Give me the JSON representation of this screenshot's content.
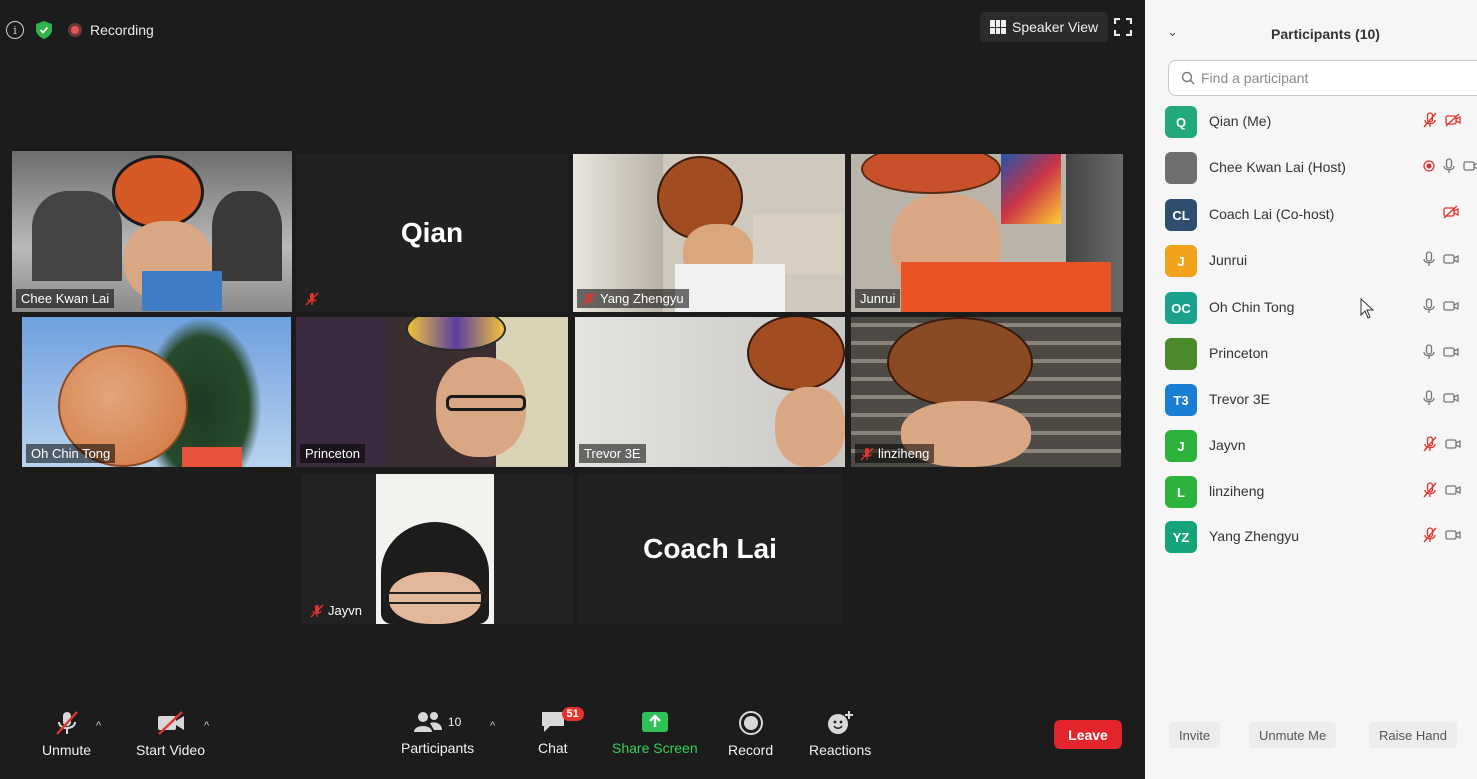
{
  "top_bar": {
    "recording_label": "Recording",
    "speaker_view_label": "Speaker View"
  },
  "tiles": [
    {
      "name": "Chee Kwan Lai",
      "muted": false,
      "active": true
    },
    {
      "name": "Qian",
      "muted": true,
      "video": false
    },
    {
      "name": "Yang Zhengyu",
      "muted": true
    },
    {
      "name": "Junrui",
      "muted": false
    },
    {
      "name": "Oh Chin Tong",
      "muted": false
    },
    {
      "name": "Princeton",
      "muted": false
    },
    {
      "name": "Trevor 3E",
      "muted": false
    },
    {
      "name": "linziheng",
      "muted": true
    },
    {
      "name": "Jayvn",
      "muted": true
    },
    {
      "name": "Coach Lai",
      "muted": false,
      "video": false
    }
  ],
  "toolbar": {
    "unmute_label": "Unmute",
    "start_video_label": "Start Video",
    "participants_label": "Participants",
    "participants_count": "10",
    "chat_label": "Chat",
    "chat_badge": "51",
    "share_screen_label": "Share Screen",
    "record_label": "Record",
    "reactions_label": "Reactions",
    "leave_label": "Leave"
  },
  "panel": {
    "title": "Participants (10)",
    "search_placeholder": "Find a participant",
    "participants": [
      {
        "initials": "Q",
        "name": "Qian (Me)",
        "color": "#22a97a",
        "mic": "muted",
        "video": "off"
      },
      {
        "initials": "",
        "name": "Chee Kwan Lai (Host)",
        "color": "#6e6e6e",
        "mic": "on",
        "video": "on",
        "recording": true
      },
      {
        "initials": "CL",
        "name": "Coach Lai (Co-host)",
        "color": "#2f4d6e",
        "mic": "none",
        "video": "off"
      },
      {
        "initials": "J",
        "name": "Junrui",
        "color": "#f0a21c",
        "mic": "on",
        "video": "on"
      },
      {
        "initials": "OC",
        "name": "Oh Chin Tong",
        "color": "#1aa28c",
        "mic": "on",
        "video": "on"
      },
      {
        "initials": "",
        "name": "Princeton",
        "color": "#4a8a2a",
        "mic": "on",
        "video": "on"
      },
      {
        "initials": "T3",
        "name": "Trevor 3E",
        "color": "#1a7fd4",
        "mic": "on",
        "video": "on"
      },
      {
        "initials": "J",
        "name": "Jayvn",
        "color": "#2bb33c",
        "mic": "muted",
        "video": "on"
      },
      {
        "initials": "L",
        "name": "linziheng",
        "color": "#2bb33c",
        "mic": "muted",
        "video": "on"
      },
      {
        "initials": "YZ",
        "name": "Yang Zhengyu",
        "color": "#14a37a",
        "mic": "muted",
        "video": "on"
      }
    ],
    "footer": {
      "invite_label": "Invite",
      "unmute_me_label": "Unmute Me",
      "raise_hand_label": "Raise Hand"
    }
  }
}
